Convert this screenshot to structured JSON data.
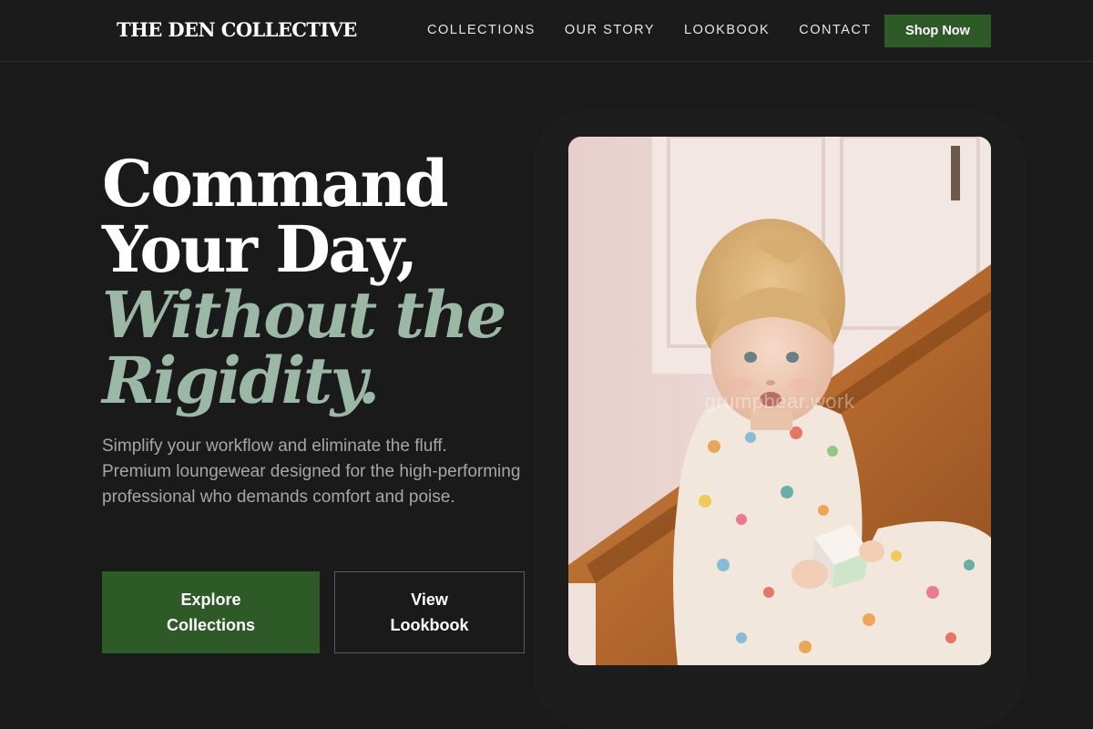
{
  "header": {
    "brand": "THE DEN COLLECTIVE",
    "nav": [
      "COLLECTIONS",
      "OUR STORY",
      "LOOKBOOK",
      "CONTACT"
    ],
    "cta": "Shop Now"
  },
  "hero": {
    "headline_lines": [
      "Command",
      "Your Day,"
    ],
    "headline_accent_lines": [
      "Without the",
      "Rigidity."
    ],
    "subtext": "Simplify your workflow and eliminate the fluff. Premium loungewear designed for the high-performing professional who demands comfort and poise.",
    "primary_button": "Explore Collections",
    "secondary_button": "View Lookbook",
    "image_watermark": "grumpbear.work"
  },
  "colors": {
    "background": "#1a1a1a",
    "accent_green": "#2d5a27",
    "headline_sage": "#9bb8a6",
    "body_text": "#a6a6a6"
  }
}
